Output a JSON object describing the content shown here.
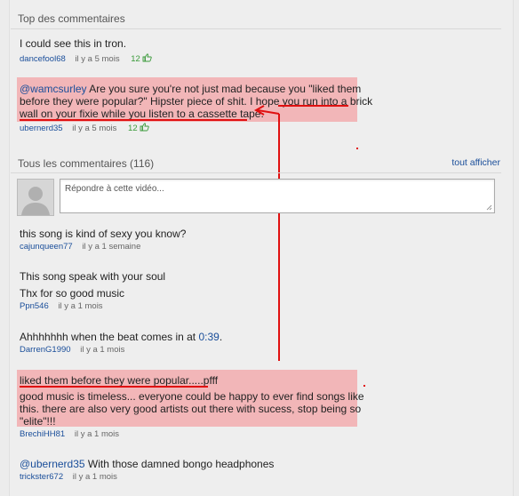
{
  "top_section": {
    "title": "Top des commentaires",
    "comments": [
      {
        "text": "I could see this in tron.",
        "user": "dancefool68",
        "age": "il y a 5 mois",
        "likes": "12"
      },
      {
        "mention": "@wamcsurley",
        "text_line1_rest": " Are you sure you're not just mad because you \"liked them",
        "text_line2": "before they were popular?\" Hipster piece of shit. I hope you run into a brick",
        "text_line3": "wall on your fixie while you listen to a cassette tape.",
        "user": "ubernerd35",
        "age": "il y a 5 mois",
        "likes": "12"
      }
    ]
  },
  "all_section": {
    "title": "Tous les commentaires (116)",
    "see_all": "tout afficher",
    "reply_placeholder": "Répondre à cette vidéo...",
    "comments": [
      {
        "text": "this song is kind of sexy you know?",
        "user": "cajunqueen77",
        "age": "il y a 1 semaine"
      },
      {
        "text_line1": "This song speak with your soul",
        "text_line2": "Thx for so good music",
        "user": "Ppn546",
        "age": "il y a 1 mois"
      },
      {
        "text_prefix": "Ahhhhhhh when the beat comes in at ",
        "time_link": "0:39",
        "text_suffix": ".",
        "user": "DarrenG1990",
        "age": "il y a 1 mois"
      },
      {
        "text_line1": "liked them before they were popular.....pfff",
        "text_line2": "good music is timeless... everyone could be happy to ever find songs like",
        "text_line3": "this. there are also very good artists out there with sucess, stop being so",
        "text_line4": "\"elite\"!!!",
        "user": "BrechiHH81",
        "age": "il y a 1 mois"
      },
      {
        "mention": "@ubernerd35",
        "text_rest": " With those damned bongo headphones",
        "user": "trickster672",
        "age": "il y a 1 mois"
      }
    ]
  },
  "colors": {
    "highlight": "#f2b6b8",
    "annotation_red": "#e01010",
    "link": "#1a4e9a",
    "likes": "#3a9a3a"
  },
  "icons": {
    "thumb": "thumbs-up-icon"
  }
}
